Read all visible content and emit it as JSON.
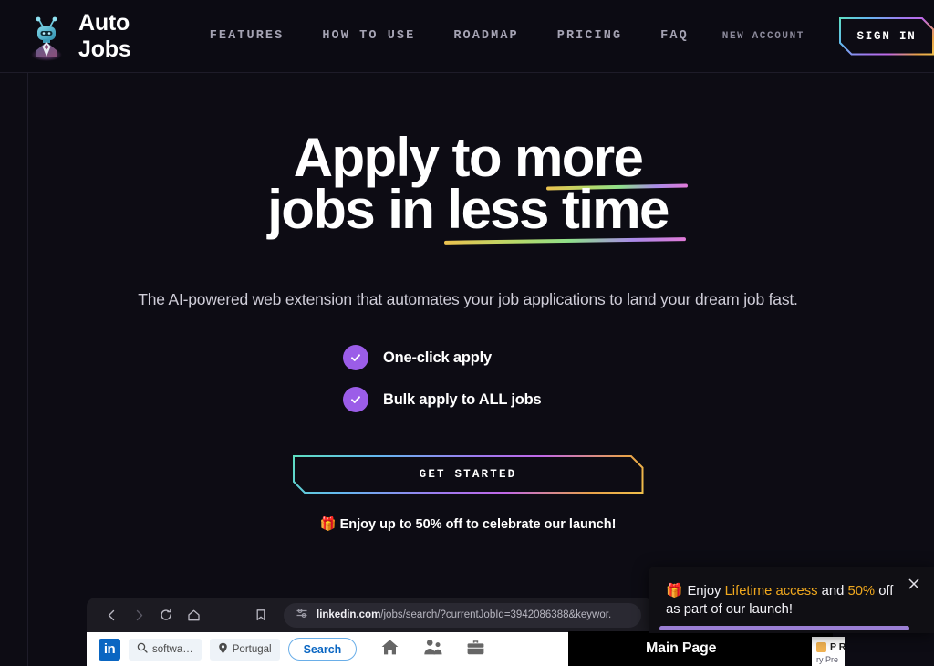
{
  "brand": {
    "name": "Auto Jobs",
    "logo_icon": "robot-logo-icon"
  },
  "nav": {
    "items": [
      {
        "label": "FEATURES"
      },
      {
        "label": "HOW TO USE"
      },
      {
        "label": "ROADMAP"
      },
      {
        "label": "PRICING"
      },
      {
        "label": "FAQ"
      }
    ],
    "new_account_label": "NEW ACCOUNT",
    "sign_in_label": "SIGN IN"
  },
  "hero": {
    "headline_line1": "Apply to more",
    "headline_line2": "jobs in less time",
    "subheadline": "The AI-powered web extension that automates your job applications to land your dream job fast.",
    "features": [
      {
        "label": "One-click apply",
        "icon": "check-circle-icon"
      },
      {
        "label": "Bulk apply to ALL jobs",
        "icon": "check-circle-icon"
      }
    ],
    "cta_label": "GET STARTED",
    "promo_emoji": "🎁",
    "promo_text": "Enjoy up to 50% off to celebrate our launch!"
  },
  "browser": {
    "back_icon": "chevron-left-icon",
    "forward_icon": "chevron-right-icon",
    "reload_icon": "reload-icon",
    "home_icon": "home-icon",
    "bookmark_icon": "bookmark-icon",
    "site_settings_icon": "site-settings-icon",
    "url_domain": "linkedin.com",
    "url_path": "/jobs/search/?currentJobId=3942086388&keywor.",
    "linkedin": {
      "logo_text": "in",
      "search_icon": "search-icon",
      "search_value": "softwa…",
      "location_icon": "location-pin-icon",
      "location_value": "Portugal",
      "search_button_label": "Search",
      "nav_icons": [
        {
          "name": "home-icon"
        },
        {
          "name": "network-icon"
        },
        {
          "name": "jobs-briefcase-icon"
        }
      ]
    }
  },
  "extension_panel": {
    "title": "Main Page"
  },
  "side_card": {
    "title": "P R",
    "subtitle": "ry Pre"
  },
  "toast": {
    "emoji": "🎁",
    "text_part1": "Enjoy ",
    "highlight1": "Lifetime access",
    "text_part2": " and ",
    "highlight2": "50%",
    "text_part3": " off as part of our launch!",
    "close_icon": "close-icon",
    "progress_color": "#9b7fd4"
  },
  "colors": {
    "background": "#0d0c14",
    "header_bg": "#0c0b13",
    "border": "#1e1c29",
    "accent_purple": "#9b5de8",
    "accent_gold": "#f0a81e",
    "text_primary": "#ffffff",
    "text_muted": "#a5a3b3"
  }
}
